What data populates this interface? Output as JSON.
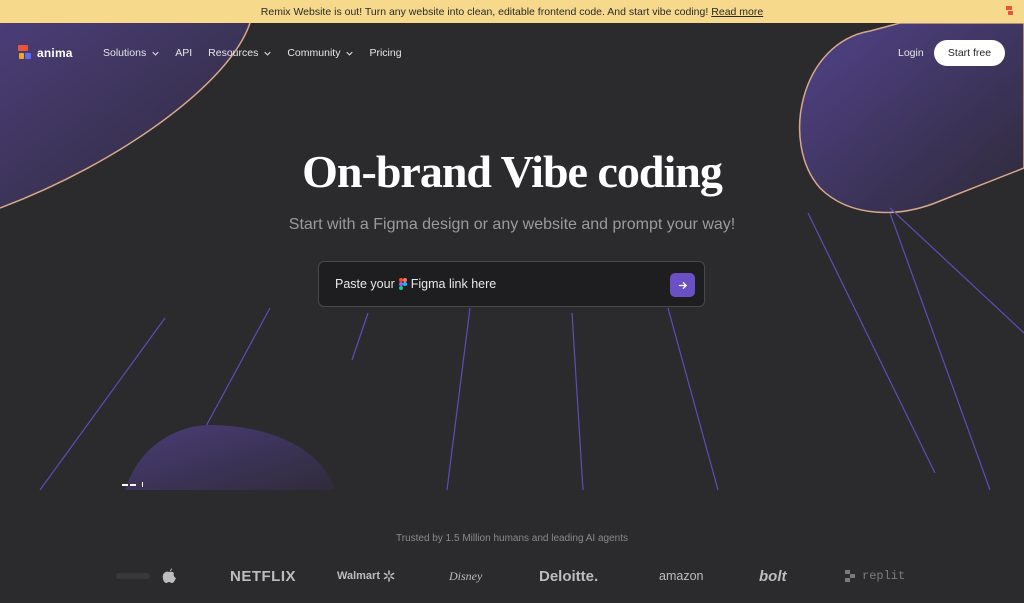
{
  "announcement": {
    "text": "Remix Website is out! Turn any website into clean, editable frontend code. And start vibe coding!",
    "link": "Read more"
  },
  "nav": {
    "logo": "anima",
    "items": [
      {
        "label": "Solutions",
        "dropdown": true
      },
      {
        "label": "API",
        "dropdown": false
      },
      {
        "label": "Resources",
        "dropdown": true
      },
      {
        "label": "Community",
        "dropdown": true
      },
      {
        "label": "Pricing",
        "dropdown": false
      }
    ],
    "login": "Login",
    "start": "Start free"
  },
  "hero": {
    "title": "On-brand Vibe coding",
    "subtitle": "Start with a Figma design or any website and prompt your way!",
    "input_before": "Paste your",
    "input_after": "Figma link here"
  },
  "trusted": {
    "text": "Trusted by 1.5 Million humans and leading AI agents",
    "brands": [
      "NETFLIX",
      "Walmart",
      "Disney",
      "Deloitte.",
      "amazon",
      "bolt",
      "replit"
    ]
  },
  "colors": {
    "accent": "#6b4fc4",
    "banner": "#f7d98b",
    "background": "#2b2a2c"
  }
}
